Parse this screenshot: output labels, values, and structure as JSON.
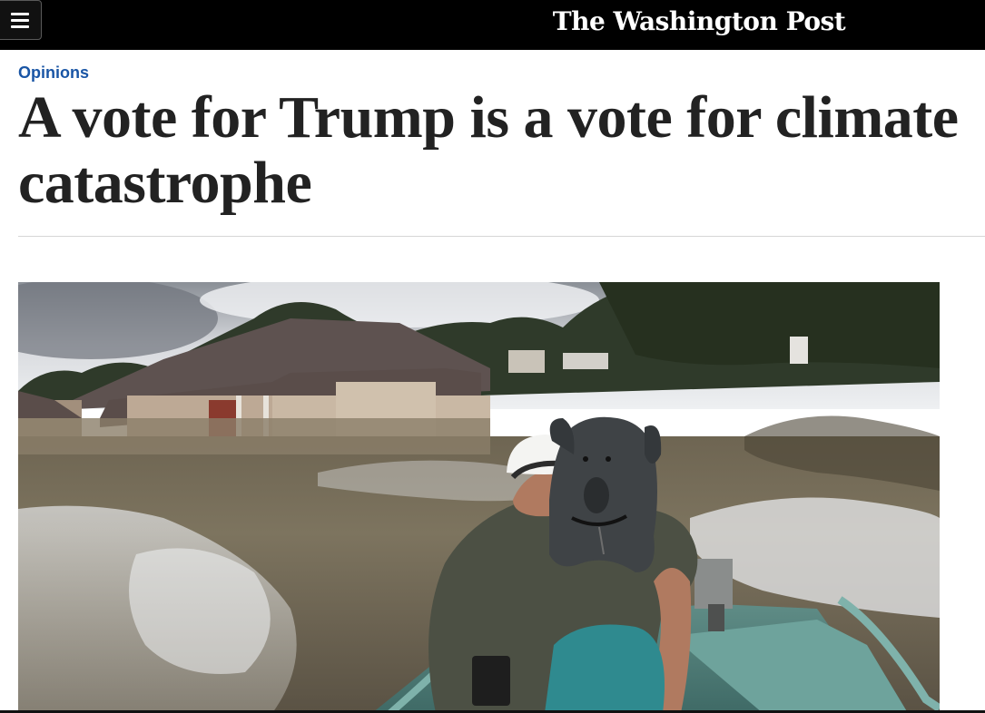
{
  "header": {
    "menu_icon": "hamburger-menu-icon",
    "masthead": "The Washington Post",
    "background": "#000000"
  },
  "article": {
    "kicker": "Opinions",
    "kicker_color": "#1955a5",
    "headline": "A vote for Trump is a vote for climate catastrophe"
  },
  "photo": {
    "subject": "flooded-neighborhood-man-with-dog-on-boat"
  }
}
